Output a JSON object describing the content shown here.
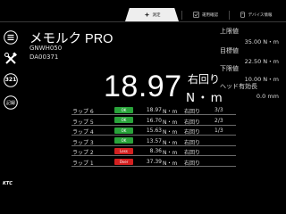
{
  "tabs": [
    {
      "label": "測定",
      "active": true
    },
    {
      "label": "運用確認",
      "active": false
    },
    {
      "label": "デバイス情報",
      "active": false
    }
  ],
  "sidebar": {
    "menu_icon": "menu-icon",
    "tools_icon": "tools-icon",
    "counter_icon": "countdown-icon",
    "counter_text": "321",
    "memory_icon": "memory-icon",
    "memory_text": "記録"
  },
  "device": {
    "title": "メモルク PRO",
    "model": "GNWH050",
    "serial": "DA00371"
  },
  "measurement": {
    "value": "18.97",
    "direction": "右回り",
    "unit": "N・m"
  },
  "limits": {
    "upper_label": "上限値",
    "upper_value": "35.00 N・m",
    "target_label": "目標値",
    "target_value": "22.50 N・m",
    "lower_label": "下限値",
    "lower_value": "10.00 N・m",
    "head_label": "ヘッド有効長",
    "head_value": "0.0 mm"
  },
  "log": [
    {
      "label": "ラップ 6",
      "status": "OK",
      "status_color": "#29a33a",
      "value": "18.97",
      "unit": "N・m",
      "direction": "右回り",
      "count": "3/3"
    },
    {
      "label": "ラップ 5",
      "status": "OK",
      "status_color": "#29a33a",
      "value": "16.70",
      "unit": "N・m",
      "direction": "右回り",
      "count": "2/3"
    },
    {
      "label": "ラップ 4",
      "status": "OK",
      "status_color": "#29a33a",
      "value": "15.63",
      "unit": "N・m",
      "direction": "右回り",
      "count": "1/3"
    },
    {
      "label": "ラップ 3",
      "status": "OK",
      "status_color": "#29a33a",
      "value": "13.57",
      "unit": "N・m",
      "direction": "右回り",
      "count": ""
    },
    {
      "label": "ラップ 2",
      "status": "Less",
      "status_color": "#d42020",
      "value": "8.36",
      "unit": "N・m",
      "direction": "右回り",
      "count": ""
    },
    {
      "label": "ラップ 1",
      "status": "Over",
      "status_color": "#d42020",
      "value": "37.39",
      "unit": "N・m",
      "direction": "右回り",
      "count": ""
    }
  ],
  "brand": "KTC",
  "colors": {
    "ok": "#29a33a",
    "ng": "#d42020",
    "background": "#000000",
    "tab_active": "#eeeeee"
  }
}
